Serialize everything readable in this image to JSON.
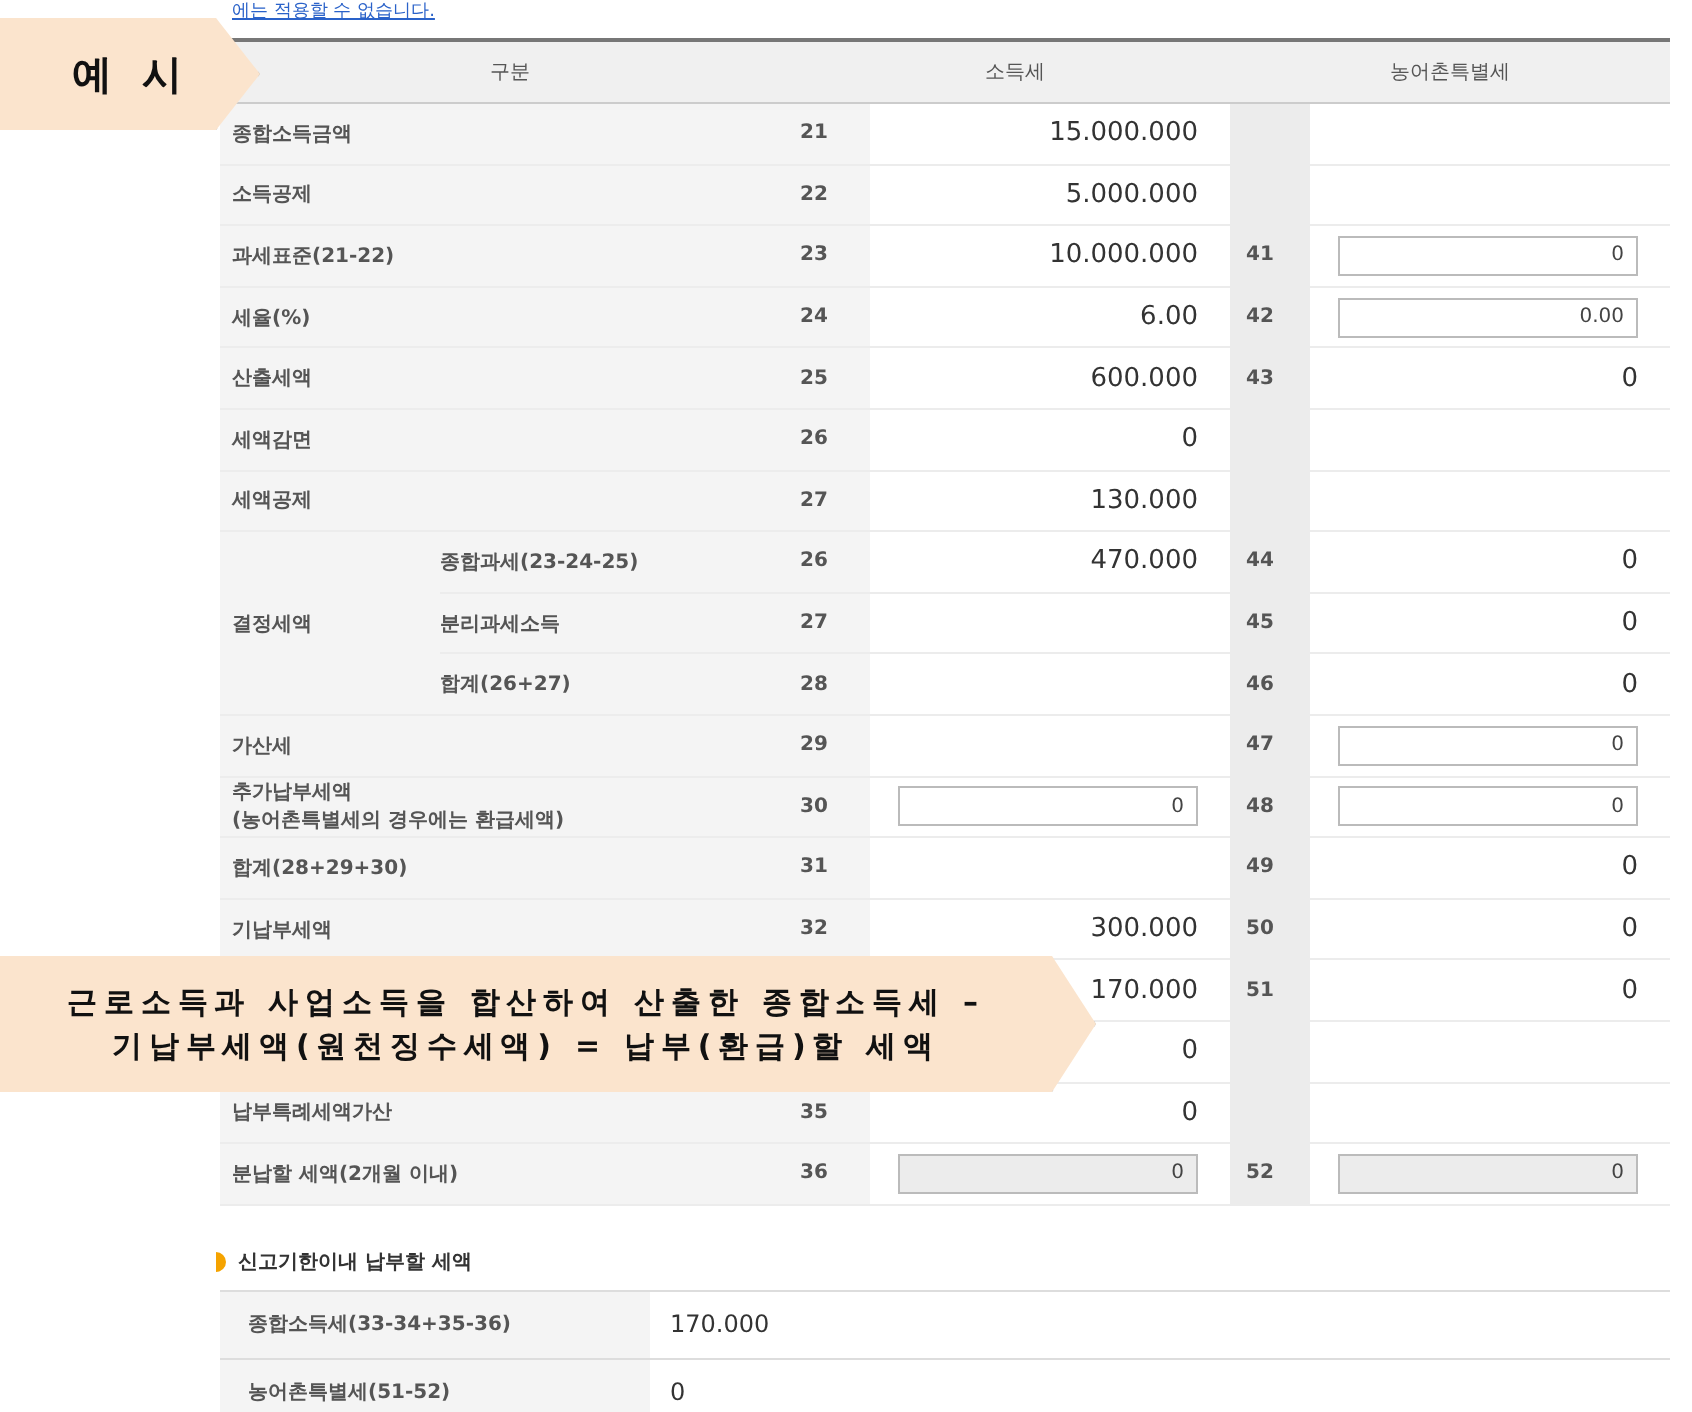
{
  "notice_link": "에는 적용할 수 없습니다.",
  "table": {
    "headers": [
      "구분",
      "소득세",
      "농어촌특별세"
    ],
    "rows": [
      {
        "label": "종합소득금액",
        "no": "21",
        "income_tax": {
          "kind": "text",
          "value": "15.000.000"
        }
      },
      {
        "label": "소득공제",
        "no": "22",
        "income_tax": {
          "kind": "text",
          "value": "5.000.000"
        }
      },
      {
        "label": "과세표준(21-22)",
        "no": "23",
        "income_tax": {
          "kind": "text",
          "value": "10.000.000"
        },
        "rural_no": "41",
        "rural_tax": {
          "kind": "input",
          "value": "0"
        }
      },
      {
        "label": "세율(%)",
        "no": "24",
        "income_tax": {
          "kind": "text",
          "value": "6.00"
        },
        "rural_no": "42",
        "rural_tax": {
          "kind": "input",
          "value": "0.00"
        }
      },
      {
        "label": "산출세액",
        "no": "25",
        "income_tax": {
          "kind": "text",
          "value": "600.000"
        },
        "rural_no": "43",
        "rural_tax": {
          "kind": "text",
          "value": "0"
        }
      },
      {
        "label": "세액감면",
        "no": "26",
        "income_tax": {
          "kind": "text",
          "value": "0"
        }
      },
      {
        "label": "세액공제",
        "no": "27",
        "income_tax": {
          "kind": "text",
          "value": "130.000"
        }
      },
      {
        "label": "결정세액",
        "children": [
          {
            "label": "종합과세(23-24-25)",
            "no": "26",
            "income_tax": {
              "kind": "text",
              "value": "470.000"
            },
            "rural_no": "44",
            "rural_tax": {
              "kind": "text",
              "value": "0"
            }
          },
          {
            "label": "분리과세소득",
            "no": "27",
            "rural_no": "45",
            "rural_tax": {
              "kind": "text",
              "value": "0"
            }
          },
          {
            "label": "합계(26+27)",
            "no": "28",
            "rural_no": "46",
            "rural_tax": {
              "kind": "text",
              "value": "0"
            }
          }
        ]
      },
      {
        "label": "가산세",
        "no": "29",
        "rural_no": "47",
        "rural_tax": {
          "kind": "input",
          "value": "0"
        }
      },
      {
        "label": "추가납부세액\n(농어촌특별세의 경우에는 환급세액)",
        "no": "30",
        "income_tax": {
          "kind": "input",
          "value": "0"
        },
        "rural_no": "48",
        "rural_tax": {
          "kind": "input",
          "value": "0"
        }
      },
      {
        "label": "합계(28+29+30)",
        "no": "31",
        "rural_no": "49",
        "rural_tax": {
          "kind": "text",
          "value": "0"
        }
      },
      {
        "label": "기납부세액",
        "no": "32",
        "income_tax": {
          "kind": "text",
          "value": "300.000"
        },
        "rural_no": "50",
        "rural_tax": {
          "kind": "text",
          "value": "0"
        }
      },
      {
        "income_tax": {
          "kind": "text",
          "value": "170.000"
        },
        "rural_no": "51",
        "rural_tax": {
          "kind": "text",
          "value": "0"
        }
      },
      {
        "income_tax": {
          "kind": "text",
          "value": "0"
        }
      },
      {
        "label": "납부특례세액가산",
        "no": "35",
        "income_tax": {
          "kind": "text",
          "value": "0"
        }
      },
      {
        "label": "분납할 세액(2개월 이내)",
        "no": "36",
        "income_tax": {
          "kind": "disabled",
          "value": "0"
        },
        "rural_no": "52",
        "rural_tax": {
          "kind": "disabled",
          "value": "0"
        }
      }
    ]
  },
  "due_section": {
    "title": "신고기한이내 납부할 세액",
    "rows": [
      {
        "label": "종합소득세(33-34+35-36)",
        "value": "170.000"
      },
      {
        "label": "농어촌특별세(51-52)",
        "value": "0"
      }
    ]
  },
  "callouts": [
    {
      "kind": "tag",
      "lines": [
        "예 시"
      ]
    },
    {
      "kind": "banner",
      "lines": [
        "근로소득과 사업소득을 합산하여 산출한 종합소득세 –",
        "기납부세액(원천징수세액) = 납부(환급)할 세액"
      ]
    }
  ]
}
